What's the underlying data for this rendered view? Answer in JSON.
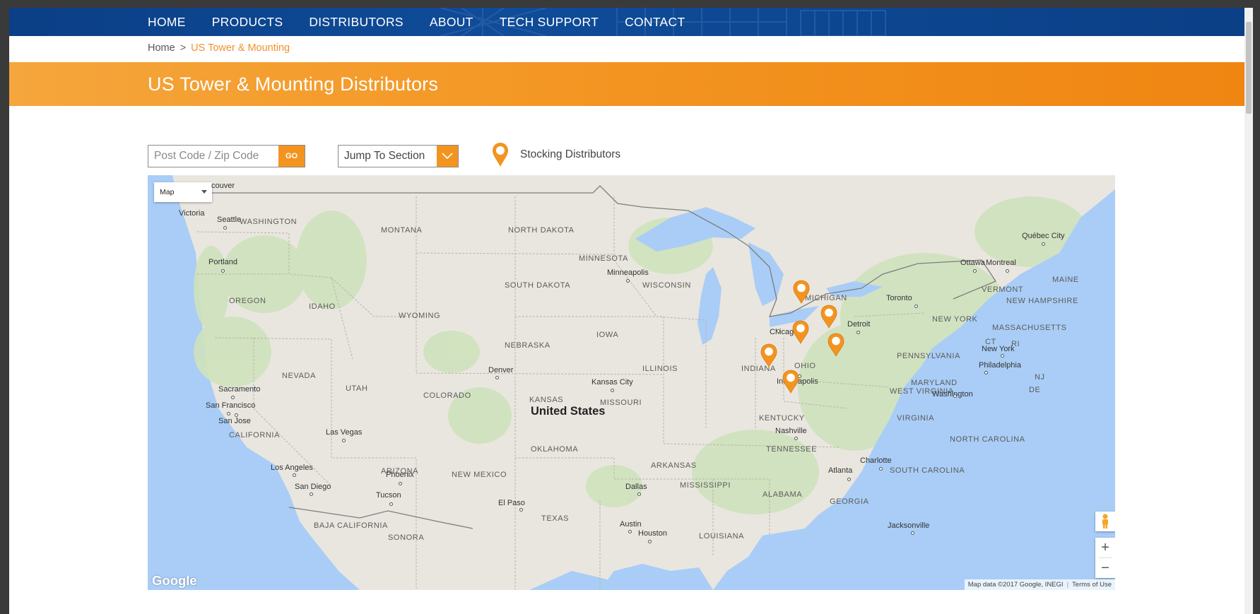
{
  "nav": {
    "items": [
      "HOME",
      "PRODUCTS",
      "DISTRIBUTORS",
      "ABOUT",
      "TECH SUPPORT",
      "CONTACT"
    ]
  },
  "breadcrumb": {
    "home": "Home",
    "separator": ">",
    "current": "US Tower & Mounting"
  },
  "banner": {
    "title": "US Tower & Mounting Distributors"
  },
  "search": {
    "placeholder": "Post Code / Zip Code",
    "value": "",
    "go_label": "GO"
  },
  "jump": {
    "label": "Jump To Section"
  },
  "legend": {
    "icon": "map-pin-icon",
    "label": "Stocking Distributors"
  },
  "map": {
    "type_selector": "Map",
    "country_label": "United States",
    "logo": "Google",
    "attribution": "Map data ©2017 Google, INEGI",
    "terms": "Terms of Use",
    "zoom_in": "+",
    "zoom_out": "−",
    "states": [
      "WASHINGTON",
      "MONTANA",
      "NORTH DAKOTA",
      "MINNESOTA",
      "SOUTH DAKOTA",
      "WISCONSIN",
      "OREGON",
      "IDAHO",
      "WYOMING",
      "IOWA",
      "NEBRASKA",
      "NEVADA",
      "UTAH",
      "COLORADO",
      "KANSAS",
      "ILLINOIS",
      "INDIANA",
      "OHIO",
      "MISSOURI",
      "CALIFORNIA",
      "KENTUCKY",
      "WEST VIRGINIA",
      "VIRGINIA",
      "PENNSYLVANIA",
      "NEW YORK",
      "VERMONT",
      "NEW HAMPSHIRE",
      "MASSACHUSETTS",
      "MAINE",
      "CT",
      "RI",
      "NJ",
      "DE",
      "MARYLAND",
      "TENNESSEE",
      "NORTH CAROLINA",
      "SOUTH CAROLINA",
      "OKLAHOMA",
      "ARKANSAS",
      "MISSISSIPPI",
      "ALABAMA",
      "GEORGIA",
      "ARIZONA",
      "NEW MEXICO",
      "TEXAS",
      "LOUISIANA",
      "BAJA CALIFORNIA",
      "SONORA",
      "MICHIGAN"
    ],
    "cities": [
      "couver",
      "Victoria",
      "Seattle",
      "Portland",
      "Minneapolis",
      "Québec City",
      "Ottawa",
      "Montreal",
      "Toronto",
      "Detroit",
      "Chicago",
      "New York",
      "Philadelphia",
      "Washington",
      "Denver",
      "Kansas City",
      "Indianapolis",
      "Sacramento",
      "San Francisco",
      "San Jose",
      "Las Vegas",
      "Nashville",
      "Charlotte",
      "Atlanta",
      "Los Angeles",
      "Phoenix",
      "San Diego",
      "Tucson",
      "El Paso",
      "Dallas",
      "Austin",
      "Houston",
      "Jacksonville"
    ],
    "distributor_pins": 6
  },
  "colors": {
    "nav_bg": "#0b3f86",
    "accent": "#f39420",
    "water": "#a9cdf6",
    "land": "#e9e6df"
  }
}
